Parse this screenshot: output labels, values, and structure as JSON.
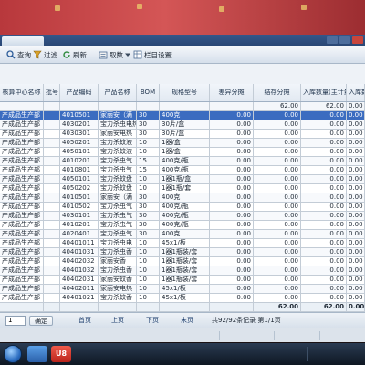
{
  "toolbar": {
    "query": "查询",
    "filter": "过滤",
    "refresh": "刷新",
    "fetch": "取数",
    "columns": "栏目设置"
  },
  "table": {
    "columns": [
      "核算中心名称",
      "批号",
      "产品编码",
      "产品名称",
      "BOM",
      "规格型号",
      "差异分摊",
      "结存分摊",
      "入库数量(主计量)",
      "入库数量"
    ],
    "summary": [
      "",
      "",
      "",
      "",
      "",
      "",
      "",
      "62.00",
      "62.00",
      "0.00"
    ],
    "rows": [
      [
        "产成品生产部",
        "",
        "4010501",
        "家丽安（满",
        "30",
        "400克",
        "0.00",
        "0.00",
        "0.00",
        "0.00"
      ],
      [
        "产成品生产部",
        "",
        "4030201",
        "宝力杀虫电热",
        "30",
        "30片/盒",
        "0.00",
        "0.00",
        "0.00",
        "0.00"
      ],
      [
        "产成品生产部",
        "",
        "4030301",
        "家丽安电热",
        "30",
        "30片/盒",
        "0.00",
        "0.00",
        "0.00",
        "0.00"
      ],
      [
        "产成品生产部",
        "",
        "4050201",
        "宝力杀蚊液",
        "10",
        "1器/盒",
        "0.00",
        "0.00",
        "0.00",
        "0.00"
      ],
      [
        "产成品生产部",
        "",
        "4050101",
        "宝力杀蚊液",
        "10",
        "1器/盒",
        "0.00",
        "0.00",
        "0.00",
        "0.00"
      ],
      [
        "产成品生产部",
        "",
        "4010201",
        "宝力杀虫气",
        "15",
        "400克/瓶",
        "0.00",
        "0.00",
        "0.00",
        "0.00"
      ],
      [
        "产成品生产部",
        "",
        "4010801",
        "宝力杀虫气",
        "15",
        "400克/瓶",
        "0.00",
        "0.00",
        "0.00",
        "0.00"
      ],
      [
        "产成品生产部",
        "",
        "4050101",
        "宝力杀蚊盘",
        "10",
        "1器1瓶/盒",
        "0.00",
        "0.00",
        "0.00",
        "0.00"
      ],
      [
        "产成品生产部",
        "",
        "4050202",
        "宝力杀蚊盘",
        "10",
        "1器1瓶/套",
        "0.00",
        "0.00",
        "0.00",
        "0.00"
      ],
      [
        "产成品生产部",
        "",
        "4010501",
        "家丽安（满",
        "30",
        "400克",
        "0.00",
        "0.00",
        "0.00",
        "0.00"
      ],
      [
        "产成品生产部",
        "",
        "4010502",
        "宝力杀虫气",
        "30",
        "400克/瓶",
        "0.00",
        "0.00",
        "0.00",
        "0.00"
      ],
      [
        "产成品生产部",
        "",
        "4030101",
        "宝力杀虫气",
        "30",
        "400克/瓶",
        "0.00",
        "0.00",
        "0.00",
        "0.00"
      ],
      [
        "产成品生产部",
        "",
        "4010201",
        "宝力杀虫气",
        "30",
        "400克/瓶",
        "0.00",
        "0.00",
        "0.00",
        "0.00"
      ],
      [
        "产成品生产部",
        "",
        "4020401",
        "宝力杀虫气",
        "30",
        "400克",
        "0.00",
        "0.00",
        "0.00",
        "0.00"
      ],
      [
        "产成品生产部",
        "",
        "40401011",
        "宝力杀虫电",
        "10",
        "45x1/板",
        "0.00",
        "0.00",
        "0.00",
        "0.00"
      ],
      [
        "产成品生产部",
        "",
        "40401031",
        "宝力杀虫香",
        "10",
        "1器1瓶装/套",
        "0.00",
        "0.00",
        "0.00",
        "0.00"
      ],
      [
        "产成品生产部",
        "",
        "40402032",
        "家丽安香",
        "10",
        "1器1瓶装/套",
        "0.00",
        "0.00",
        "0.00",
        "0.00"
      ],
      [
        "产成品生产部",
        "",
        "40401032",
        "宝力杀虫香",
        "10",
        "1器1瓶装/套",
        "0.00",
        "0.00",
        "0.00",
        "0.00"
      ],
      [
        "产成品生产部",
        "",
        "40402031",
        "家丽安蚊香",
        "10",
        "1器1瓶装/套",
        "0.00",
        "0.00",
        "0.00",
        "0.00"
      ],
      [
        "产成品生产部",
        "",
        "40402011",
        "家丽安电热",
        "10",
        "45x1/板",
        "0.00",
        "0.00",
        "0.00",
        "0.00"
      ],
      [
        "产成品生产部",
        "",
        "40401021",
        "宝力杀蚊香",
        "10",
        "45x1/板",
        "0.00",
        "0.00",
        "0.00",
        "0.00"
      ]
    ],
    "total": [
      "",
      "",
      "",
      "",
      "",
      "",
      "",
      "62.00",
      "62.00",
      "0.00"
    ]
  },
  "pager": {
    "page_input": "1",
    "confirm": "确定",
    "first": "首页",
    "prev": "上页",
    "next": "下页",
    "last": "末页",
    "info": "共92/92条记录 第1/1页"
  },
  "taskbar": {
    "app_icon_label": "U8"
  },
  "colors": {
    "wall": "#b8383c",
    "title_bar": "#2a4775",
    "header_bg": "#e2e9f2",
    "grid_line": "#c3ccd6",
    "selected_row": "#3b6cc0"
  }
}
